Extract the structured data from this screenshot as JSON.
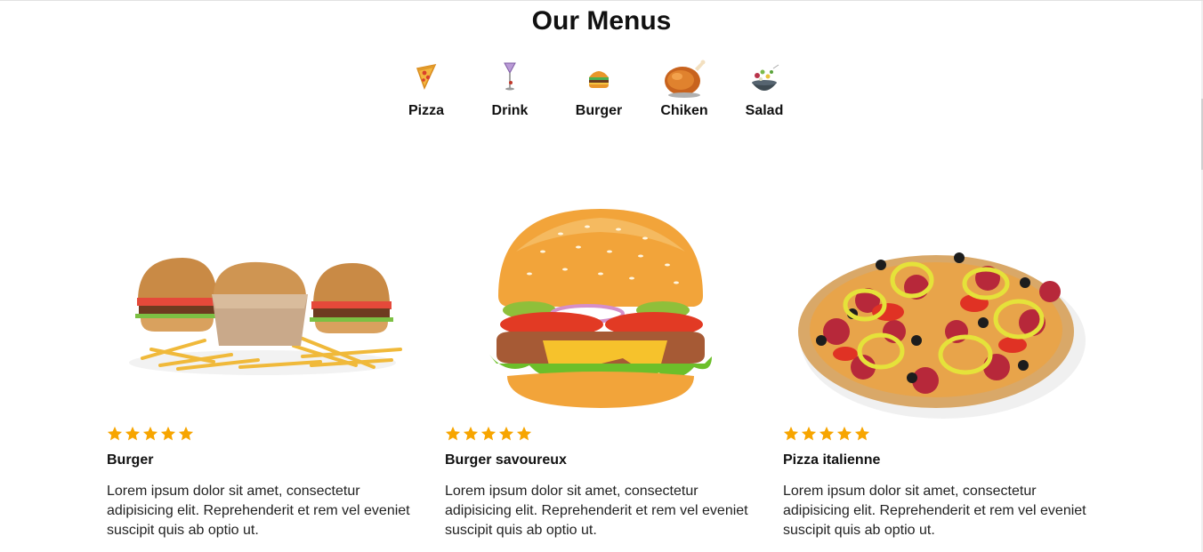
{
  "header": {
    "title": "Our Menus"
  },
  "categories": [
    {
      "label": "Pizza",
      "icon": "pizza-icon"
    },
    {
      "label": "Drink",
      "icon": "drink-icon"
    },
    {
      "label": "Burger",
      "icon": "burger-icon"
    },
    {
      "label": "Chiken",
      "icon": "chicken-icon"
    },
    {
      "label": "Salad",
      "icon": "salad-icon"
    }
  ],
  "cards": [
    {
      "title": "Burger",
      "rating": 5,
      "description": "Lorem ipsum dolor sit amet, consectetur adipisicing elit. Reprehenderit et rem vel eveniet suscipit quis ab optio ut.",
      "image": "burger-sliders-with-fries-image"
    },
    {
      "title": "Burger savoureux",
      "rating": 5,
      "description": "Lorem ipsum dolor sit amet, consectetur adipisicing elit. Reprehenderit et rem vel eveniet suscipit quis ab optio ut.",
      "image": "cheeseburger-image"
    },
    {
      "title": "Pizza italienne",
      "rating": 5,
      "description": "Lorem ipsum dolor sit amet, consectetur adipisicing elit. Reprehenderit et rem vel eveniet suscipit quis ab optio ut.",
      "image": "pepperoni-pizza-image"
    }
  ],
  "colors": {
    "star": "#f7a500",
    "text": "#111111"
  }
}
